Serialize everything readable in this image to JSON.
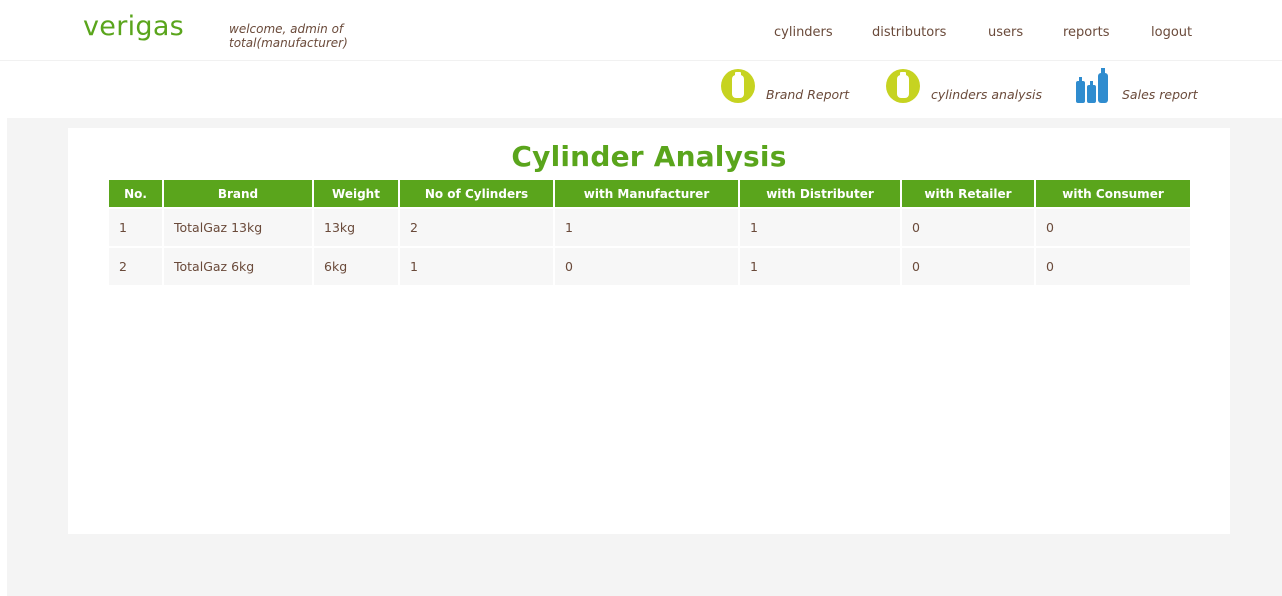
{
  "app": {
    "logo": "verigas",
    "welcome": "welcome, admin of total(manufacturer)"
  },
  "nav": {
    "items": [
      "cylinders",
      "distributors",
      "users",
      "reports",
      "logout"
    ]
  },
  "subnav": {
    "items": [
      {
        "label": "Brand Report",
        "icon": "cylinder-icon"
      },
      {
        "label": "cylinders analysis",
        "icon": "cylinder-icon"
      },
      {
        "label": "Sales report",
        "icon": "cylinders-group-icon"
      }
    ]
  },
  "colors": {
    "accent": "#5aa51c",
    "text": "#6a4a3a",
    "icon_yellow": "#c6d321",
    "icon_blue": "#2f8ccf"
  },
  "main": {
    "title": "Cylinder Analysis",
    "table": {
      "headers": [
        "No.",
        "Brand",
        "Weight",
        "No of Cylinders",
        "with Manufacturer",
        "with Distributer",
        "with Retailer",
        "with Consumer"
      ],
      "rows": [
        [
          "1",
          "TotalGaz 13kg",
          "13kg",
          "2",
          "1",
          "1",
          "0",
          "0"
        ],
        [
          "2",
          "TotalGaz 6kg",
          "6kg",
          "1",
          "0",
          "1",
          "0",
          "0"
        ]
      ]
    }
  }
}
